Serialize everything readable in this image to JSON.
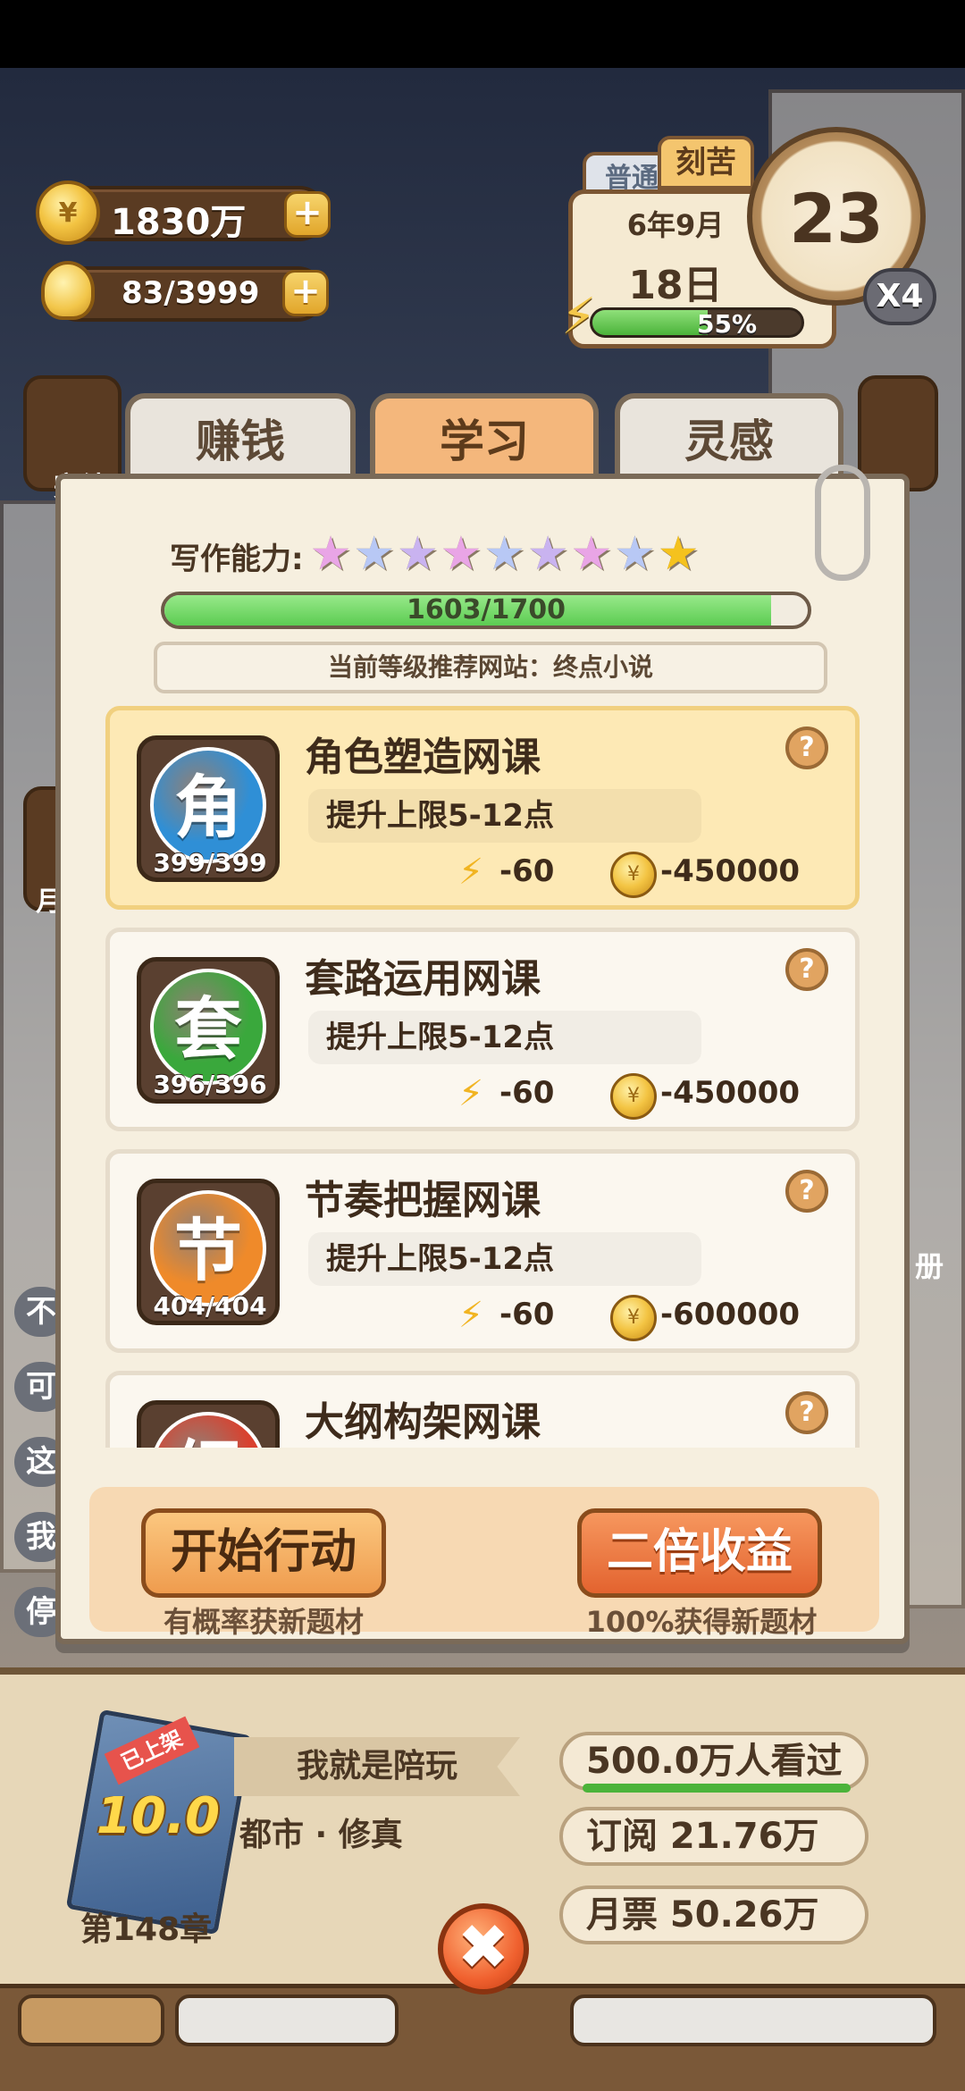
{
  "currency": {
    "coins": "1830万",
    "ideas": "83/3999",
    "plus": "+"
  },
  "calendar": {
    "mode_normal": "普通",
    "mode_hard": "刻苦",
    "year_month": "6年9月",
    "day": "18日",
    "clock_value": "23",
    "multiplier": "X4",
    "energy_percent_label": "55%",
    "energy_fraction": 0.55
  },
  "side": {
    "left_label_1": "完结",
    "left_label_2": "月",
    "right_label": "册",
    "left_chars": [
      "不",
      "可",
      "这",
      "我",
      "停"
    ]
  },
  "tabs": [
    {
      "label": "赚钱",
      "active": false
    },
    {
      "label": "学习",
      "active": true
    },
    {
      "label": "灵感",
      "active": false
    }
  ],
  "ability": {
    "label": "写作能力:",
    "stars_total": 9,
    "stars_gold": 1,
    "progress_text": "1603/1700",
    "progress_fraction": 0.943,
    "recommend": "当前等级推荐网站：终点小说"
  },
  "courses": [
    {
      "char": "角",
      "color": "#2f8fd6",
      "count": "399/399",
      "title": "角色塑造网课",
      "desc": "提升上限5-12点",
      "energy": "-60",
      "money": "-450000",
      "highlight": true
    },
    {
      "char": "套",
      "color": "#3aa83c",
      "count": "396/396",
      "title": "套路运用网课",
      "desc": "提升上限5-12点",
      "energy": "-60",
      "money": "-450000",
      "highlight": false
    },
    {
      "char": "节",
      "color": "#ef8a2a",
      "count": "404/404",
      "title": "节奏把握网课",
      "desc": "提升上限5-12点",
      "energy": "-60",
      "money": "-600000",
      "highlight": false
    },
    {
      "char": "纲",
      "color": "#d9412f",
      "count": "",
      "title": "大纲构架网课",
      "desc": "",
      "energy": "",
      "money": "",
      "highlight": false
    }
  ],
  "help_glyph": "?",
  "actions": {
    "start_label": "开始行动",
    "start_sub": "有概率获新题材",
    "double_label": "二倍收益",
    "double_sub": "100%获得新题材"
  },
  "book": {
    "badge": "已上架",
    "score": "10.0",
    "chapter": "第148章",
    "name": "我就是陪玩",
    "genre": "都市 · 修真",
    "views": "500.0万人看过",
    "subscribe": "订阅  21.76万",
    "monthly": "月票  50.26万"
  },
  "close_glyph": "✖"
}
